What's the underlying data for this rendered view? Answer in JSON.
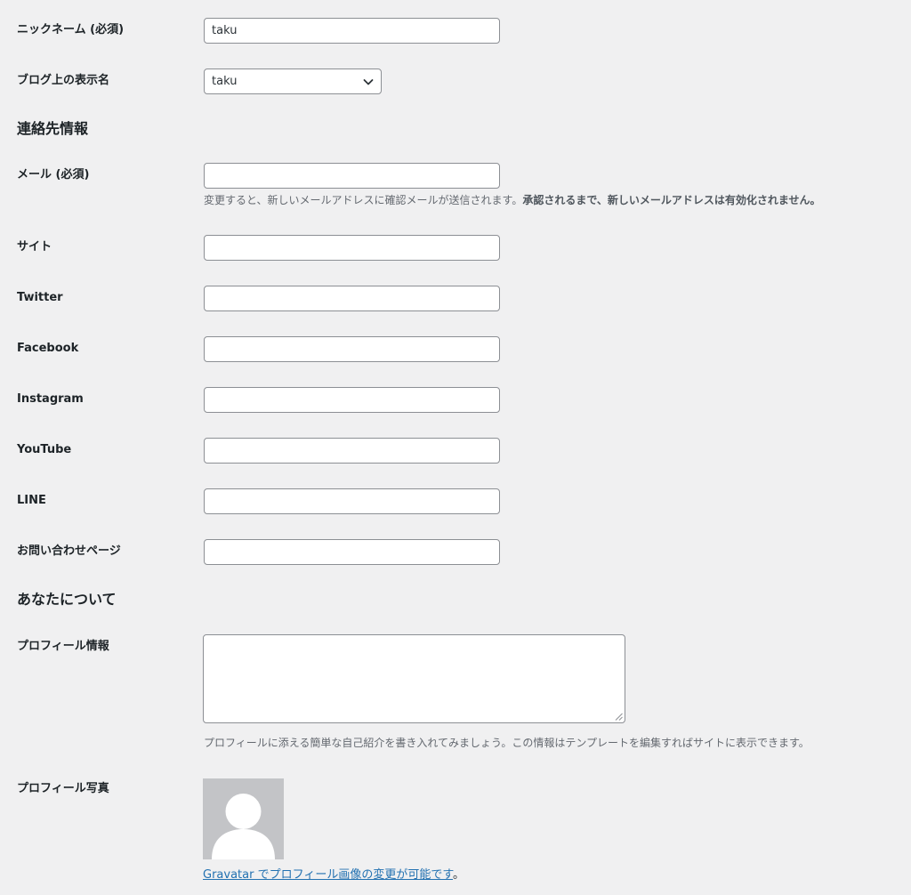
{
  "nickname": {
    "label": "ニックネーム (必須)",
    "value": "taku"
  },
  "display_name": {
    "label": "ブログ上の表示名",
    "selected": "taku"
  },
  "contact_section": {
    "heading": "連絡先情報"
  },
  "email": {
    "label": "メール (必須)",
    "value": "",
    "description_plain": "変更すると、新しいメールアドレスに確認メールが送信されます。",
    "description_bold": "承認されるまで、新しいメールアドレスは有効化されません。"
  },
  "site": {
    "label": "サイト",
    "value": ""
  },
  "twitter": {
    "label": "Twitter",
    "value": ""
  },
  "facebook": {
    "label": "Facebook",
    "value": ""
  },
  "instagram": {
    "label": "Instagram",
    "value": ""
  },
  "youtube": {
    "label": "YouTube",
    "value": ""
  },
  "line": {
    "label": "LINE",
    "value": ""
  },
  "contact_page": {
    "label": "お問い合わせページ",
    "value": ""
  },
  "about_section": {
    "heading": "あなたについて"
  },
  "bio": {
    "label": "プロフィール情報",
    "value": "",
    "description": "プロフィールに添える簡単な自己紹介を書き入れてみましょう。この情報はテンプレートを編集すればサイトに表示できます。"
  },
  "profile_picture": {
    "label": "プロフィール写真",
    "link_text": "Gravatar でプロフィール画像の変更が可能です",
    "suffix": "。"
  },
  "colors": {
    "background": "#f0f0f1",
    "link": "#2271b1",
    "input_border": "#8c8f94",
    "avatar_bg": "#c3c4c7"
  }
}
